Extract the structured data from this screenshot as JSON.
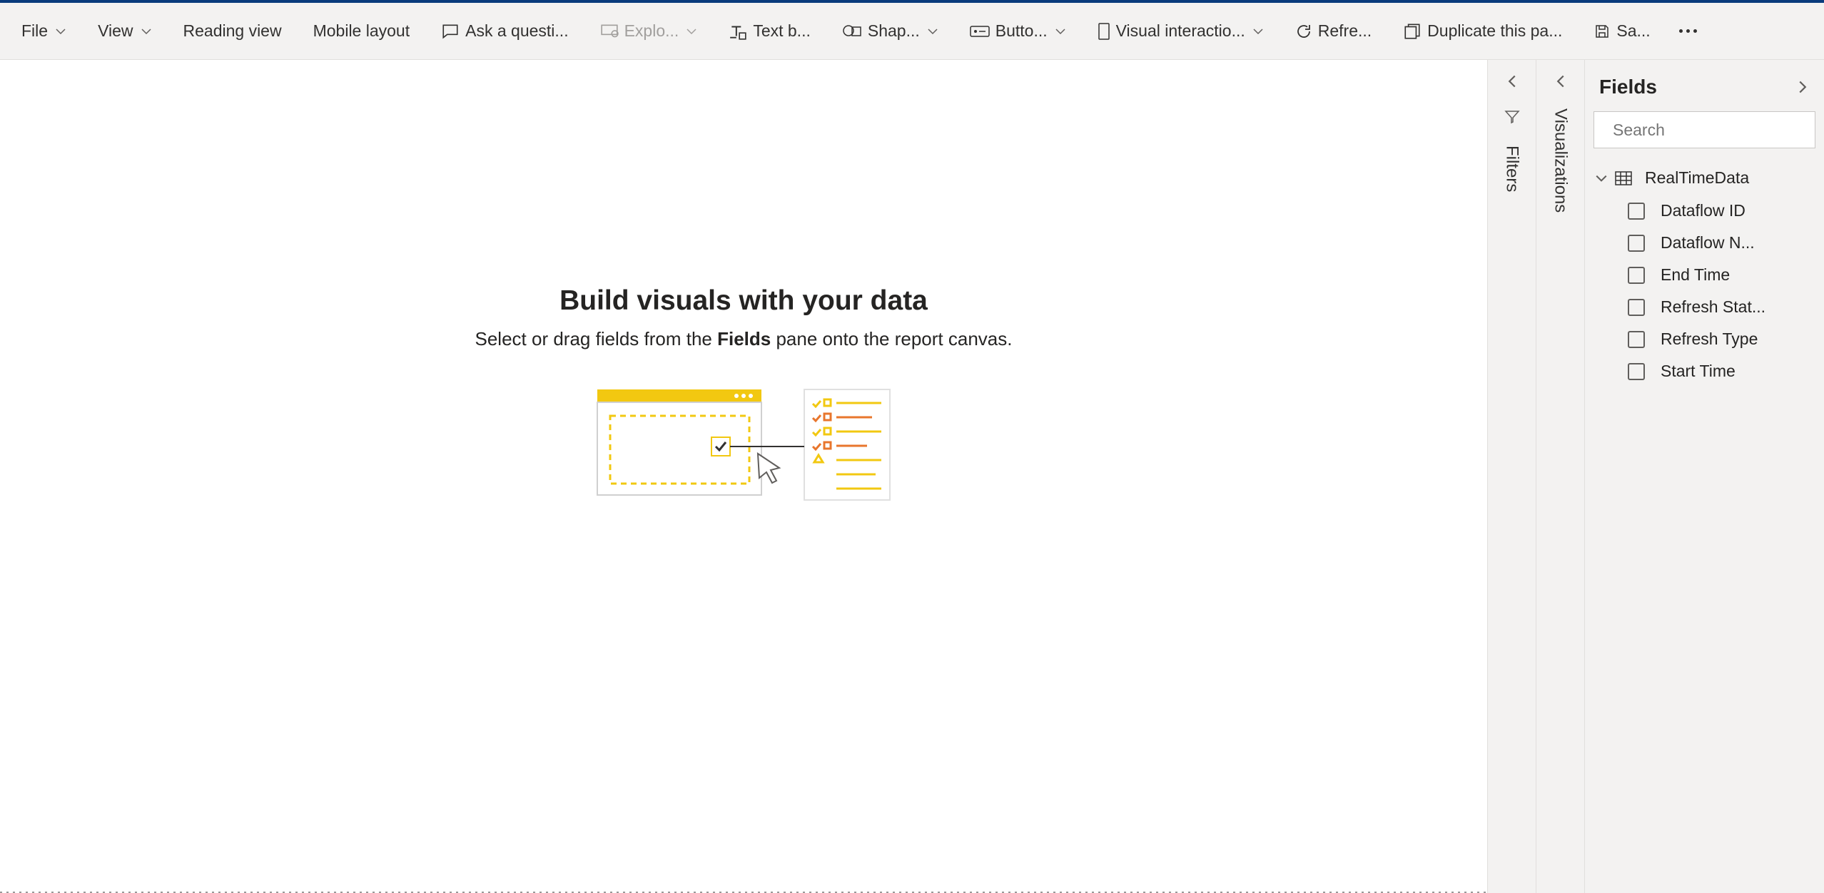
{
  "toolbar": {
    "file": "File",
    "view": "View",
    "reading_view": "Reading view",
    "mobile_layout": "Mobile layout",
    "ask_question": "Ask a questi...",
    "explore": "Explo...",
    "text_box": "Text b...",
    "shapes": "Shap...",
    "buttons": "Butto...",
    "visual_interactions": "Visual interactio...",
    "refresh": "Refre...",
    "duplicate_page": "Duplicate this pa...",
    "save": "Sa..."
  },
  "canvas": {
    "title": "Build visuals with your data",
    "subtitle_pre": "Select or drag fields from the ",
    "subtitle_bold": "Fields",
    "subtitle_post": " pane onto the report canvas."
  },
  "panes": {
    "filters": "Filters",
    "visualizations": "Visualizations"
  },
  "fields": {
    "title": "Fields",
    "search_placeholder": "Search",
    "table_name": "RealTimeData",
    "items": [
      {
        "label": "Dataflow ID"
      },
      {
        "label": "Dataflow N..."
      },
      {
        "label": "End Time"
      },
      {
        "label": "Refresh Stat..."
      },
      {
        "label": "Refresh Type"
      },
      {
        "label": "Start Time"
      }
    ]
  }
}
